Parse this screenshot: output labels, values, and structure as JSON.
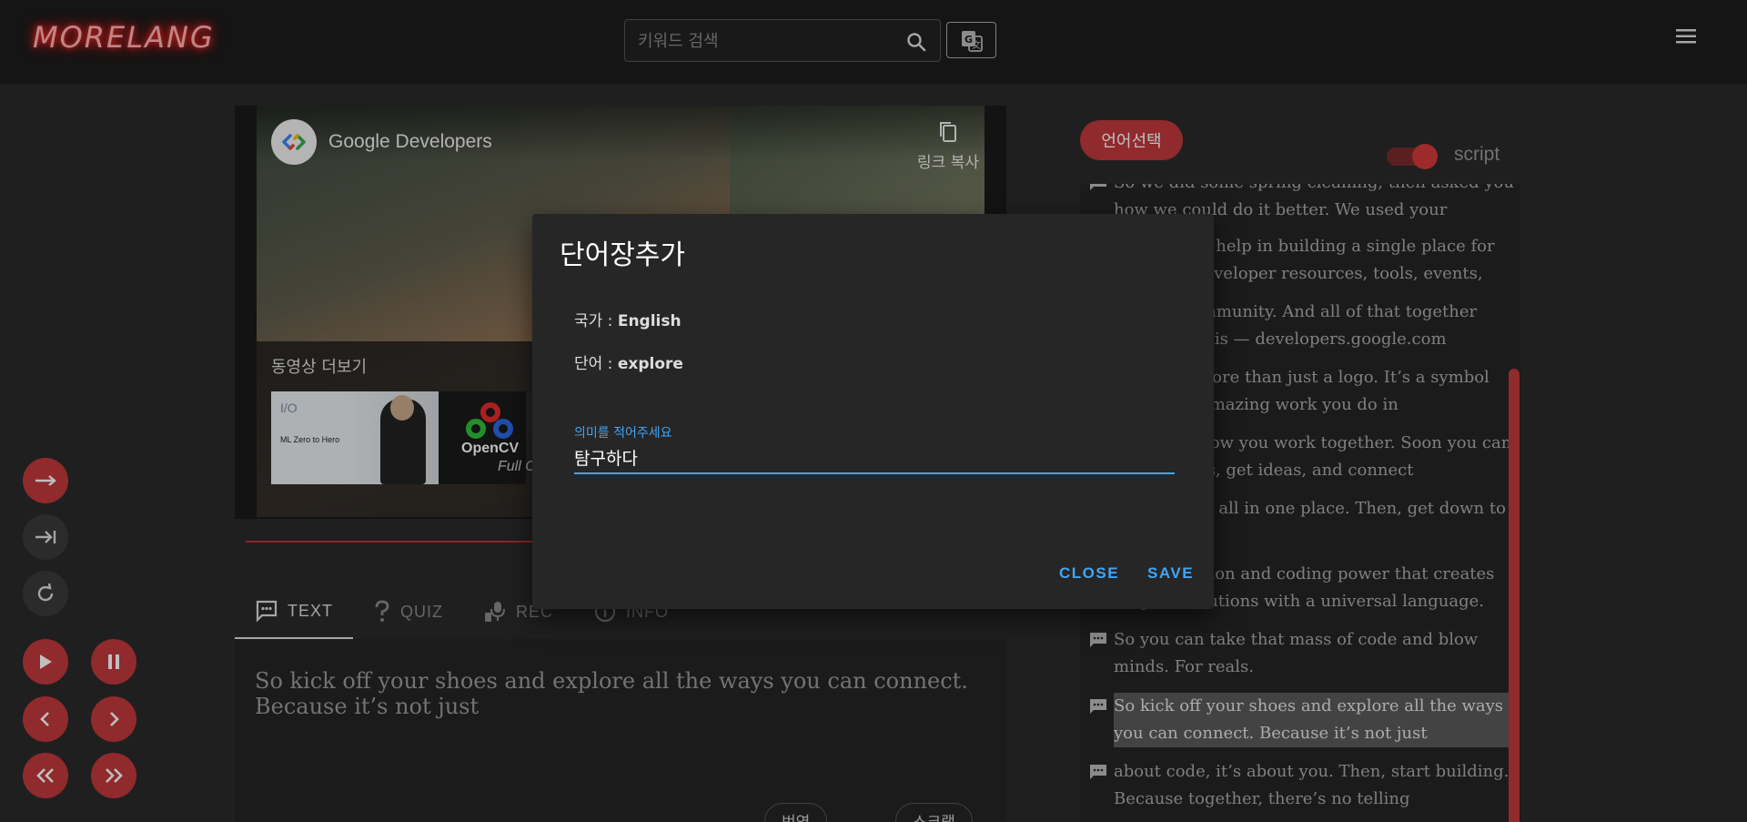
{
  "header": {
    "logo": "MORELANG",
    "search_placeholder": "키워드 검색",
    "search_icon": "search-icon",
    "translate_icon": "translate-icon",
    "menu_icon": "hamburger-menu-icon"
  },
  "video": {
    "channel_name": "Google Developers",
    "copy_link_label": "링크 복사",
    "more_videos_label": "동영상 더보기",
    "thumbnails": [
      {
        "logo": "I/O",
        "title": "ML Zero to Hero"
      },
      {
        "title_line1": "OpenCV",
        "title_line2": "Full C"
      }
    ]
  },
  "tabs": [
    {
      "label": "TEXT",
      "icon": "text-message-icon",
      "active": true
    },
    {
      "label": "QUIZ",
      "icon": "question-icon",
      "active": false
    },
    {
      "label": "REC",
      "icon": "mic-icon",
      "active": false
    },
    {
      "label": "INFO",
      "icon": "info-icon",
      "active": false
    }
  ],
  "text_panel": {
    "content": "So kick off your shoes and explore all the ways you can connect. Because it’s not just",
    "translate_button": "번역",
    "scrap_button": "스크랩"
  },
  "controls": {
    "next_icon": "arrow-right-icon",
    "skip_icon": "skip-to-end-icon",
    "repeat_icon": "refresh-icon",
    "play_icon": "play-icon",
    "pause_icon": "pause-icon",
    "prev_icon": "chevron-left-icon",
    "fwd_icon": "chevron-right-icon",
    "rewind_icon": "double-chevron-left-icon",
    "fastforward_icon": "double-chevron-right-icon"
  },
  "script_panel": {
    "language_button": "언어선택",
    "toggle_label": "script",
    "toggle_on": true,
    "lines": [
      "So we did some spring cleaning, then asked you how we could do it better. We used your",
      "feedback to help in building a single place for all of our developer resources, tools, events,",
      "and the community. And all of that together looks like this — developers.google.com",
      "It’s much more than just a logo. It’s a symbol for all the amazing work you do in",
      "code, and how you work together. Soon you can share builds, get ideas, and connect",
      "with others, all in one place. Then, get down to business.",
      "It’s inspiration and coding power that creates magical solutions with a universal language.",
      "So you can take that mass of code and blow minds. For reals.",
      "So kick off your shoes and explore all the ways you can connect. Because it’s not just",
      "about code, it’s about you. Then, start building. Because together, there’s no telling"
    ],
    "highlighted_index": 8
  },
  "dialog": {
    "title": "단어장추가",
    "country_label": "국가 : ",
    "country_value": "English",
    "word_label": "단어 : ",
    "word_value": "explore",
    "meaning_label": "의미를 적어주세요",
    "meaning_value": "탐구하다",
    "close_button": "CLOSE",
    "save_button": "SAVE"
  },
  "colors": {
    "accent_red": "#c0393b",
    "dialog_blue": "#42a5f5",
    "background": "#2a2a2a"
  }
}
